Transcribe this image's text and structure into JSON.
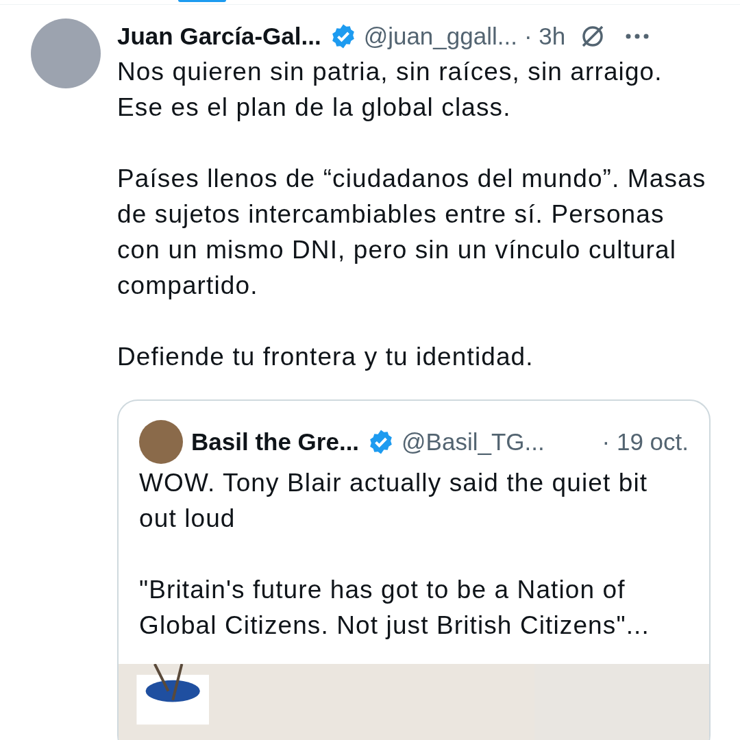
{
  "post": {
    "author": "Juan García-Gal...",
    "verified": true,
    "handle": "@juan_ggall...",
    "time": "· 3h",
    "paragraphs": [
      "Nos quieren sin patria, sin raíces, sin arraigo. Ese es el plan de la global class.",
      "Países llenos de “ciudadanos del mundo”. Masas de sujetos intercambiables entre sí. Personas con un mismo DNI, pero sin un vínculo cultural compartido.",
      "Defiende tu frontera y tu identidad."
    ],
    "quoted": {
      "author": "Basil the Gre...",
      "verified": true,
      "handle": "@Basil_TG...",
      "time": "· 19 oct.",
      "paragraphs": [
        "WOW. Tony Blair actually said the quiet bit out loud",
        "\"Britain's future has got to be a Nation of Global Citizens. Not just British Citizens\"..."
      ],
      "media": {
        "kind": "picture"
      }
    }
  }
}
